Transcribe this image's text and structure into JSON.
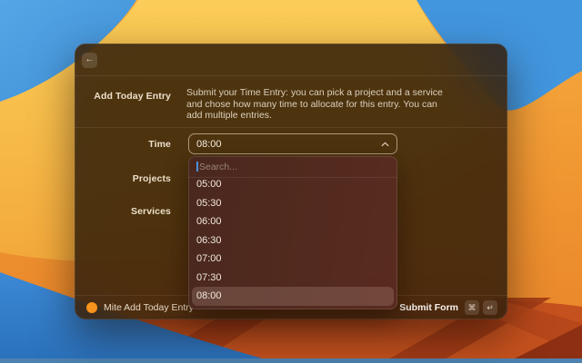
{
  "window": {
    "header": {
      "back_icon": "←"
    },
    "form": {
      "title_label": "Add Today Entry",
      "description": "Submit your Time Entry: you can pick a project and a service and chose how many time to allocate for this entry. You can add multiple entries.",
      "fields": [
        {
          "label": "Time",
          "value": "08:00"
        },
        {
          "label": "Projects"
        },
        {
          "label": "Services"
        }
      ]
    },
    "dropdown": {
      "search_placeholder": "Search...",
      "options": [
        "05:00",
        "05:30",
        "06:00",
        "06:30",
        "07:00",
        "07:30",
        "08:00"
      ],
      "selected": "08:00"
    },
    "footer": {
      "app_name": "Mite Add Today Entry",
      "action_label": "Submit Form",
      "shortcut_keys": [
        "⌘",
        "↵"
      ]
    }
  },
  "colors": {
    "mite_orange": "#F7941D",
    "caret_blue": "#4E8FDB",
    "window_tint": "#34210F",
    "dropdown_tint": "#4C2A21"
  }
}
